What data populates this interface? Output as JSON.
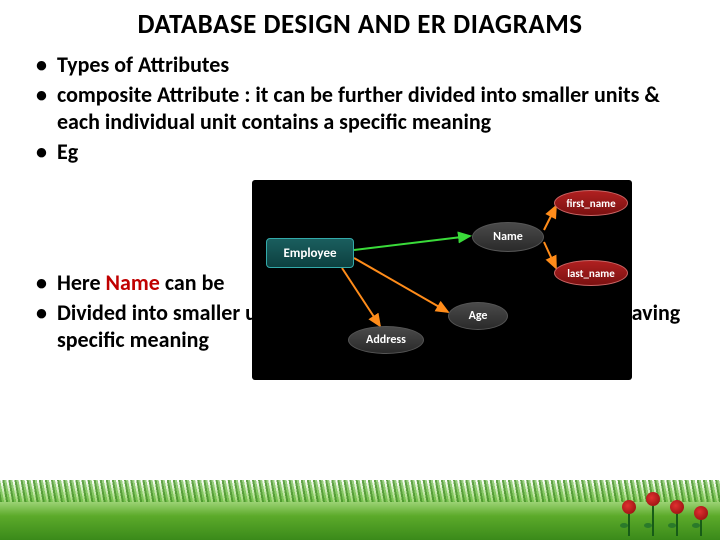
{
  "title": "DATABASE DESIGN AND ER DIAGRAMS",
  "bullets": {
    "b1": "Types of Attributes",
    "b2a": "composite Attribute",
    "b2b": " : it can be further divided into smaller units & each individual unit contains a specific  meaning",
    "b3": "Eg",
    "b4a": "Here ",
    "b4b": "Name",
    "b4c": " can be",
    "b5": "Divided into smaller units, First_name & Last_name and both having specific meaning"
  },
  "diagram": {
    "entity": "Employee",
    "name": "Name",
    "age": "Age",
    "address": "Address",
    "first": "first_name",
    "last": "last_name"
  }
}
